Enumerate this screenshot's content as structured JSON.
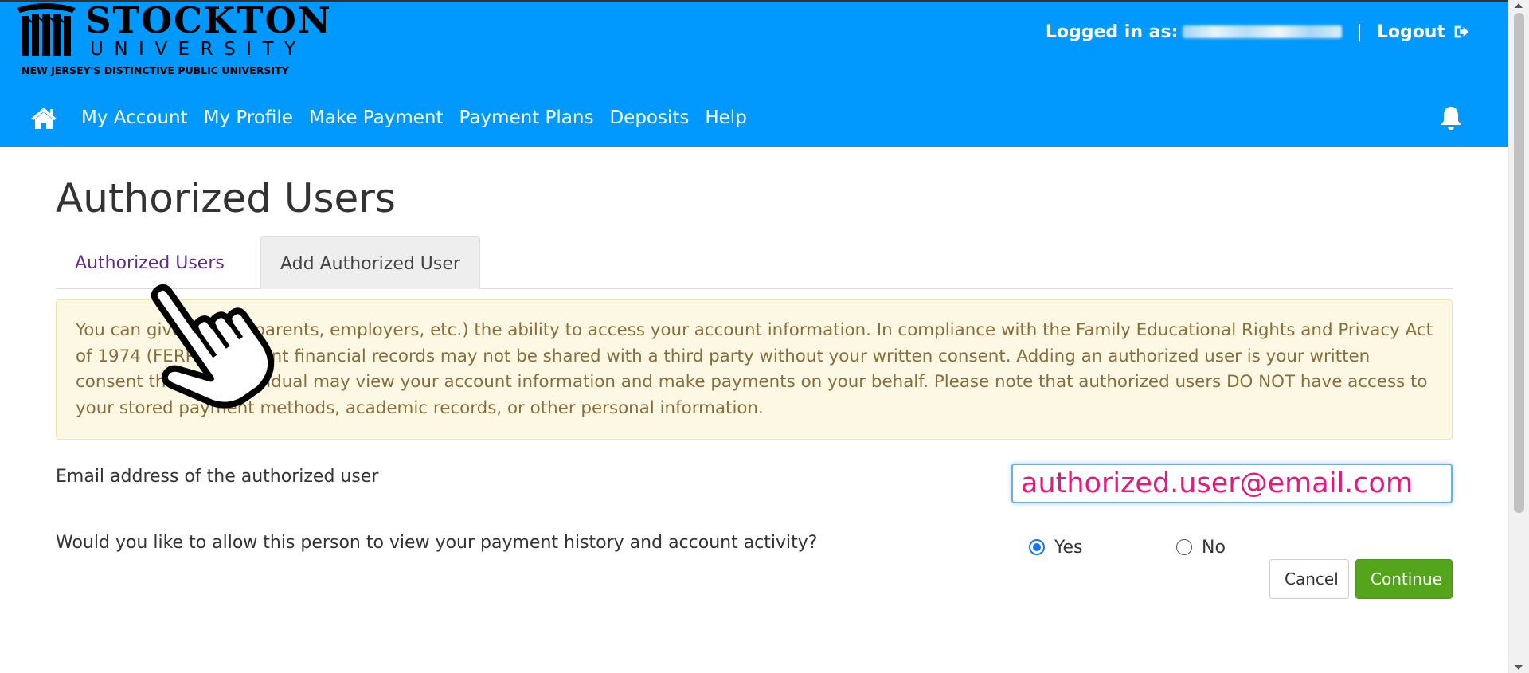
{
  "branding": {
    "name": "STOCKTON",
    "subname": "UNIVERSITY",
    "tagline": "NEW JERSEY'S DISTINCTIVE PUBLIC UNIVERSITY"
  },
  "header": {
    "logged_in_label": "Logged in as:",
    "separator": "|",
    "logout_label": "Logout"
  },
  "nav": {
    "items": [
      {
        "label": "My Account"
      },
      {
        "label": "My Profile"
      },
      {
        "label": "Make Payment"
      },
      {
        "label": "Payment Plans"
      },
      {
        "label": "Deposits"
      },
      {
        "label": "Help"
      }
    ]
  },
  "page": {
    "title": "Authorized Users"
  },
  "tabs": [
    {
      "label": "Authorized Users",
      "active": false
    },
    {
      "label": "Add Authorized User",
      "active": true
    }
  ],
  "notice": {
    "text": "You can give others (parents, employers, etc.) the ability to access your account information. In compliance with the Family Educational Rights and Privacy Act of 1974 (FERPA), student financial records may not be shared with a third party without your written consent. Adding an authorized user is your written consent that this individual may view your account information and make payments on your behalf. Please note that authorized users DO NOT have access to your stored payment methods, academic records, or other personal information."
  },
  "form": {
    "email_label": "Email address of the authorized user",
    "email_value": "authorized.user@email.com",
    "question_label": "Would you like to allow this person to view your payment history and account activity?",
    "options": [
      {
        "label": "Yes",
        "selected": true
      },
      {
        "label": "No",
        "selected": false
      }
    ],
    "cancel_label": "Cancel",
    "continue_label": "Continue"
  },
  "colors": {
    "header_bg": "#0199fe",
    "continue_bg": "#55a51c",
    "notice_bg": "#fcf8e3",
    "notice_text": "#8a6d3b",
    "email_text": "#e8177d"
  }
}
